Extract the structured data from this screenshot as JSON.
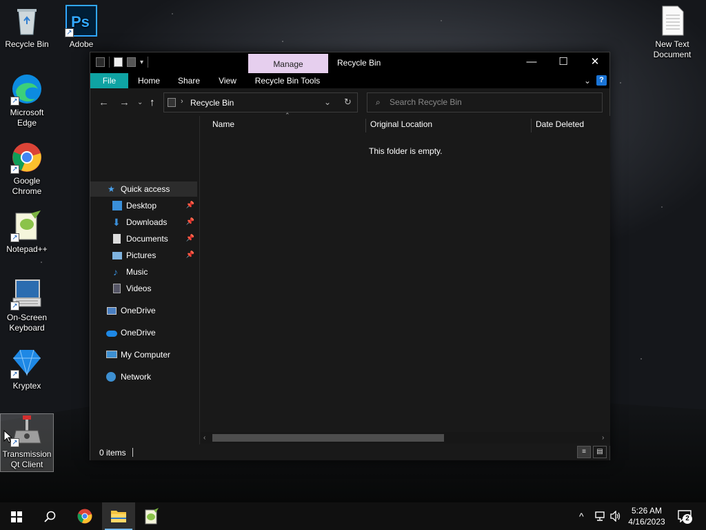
{
  "desktop": {
    "icons": [
      {
        "label": "Recycle Bin"
      },
      {
        "label": "Adobe Photosh"
      },
      {
        "label": "Microsoft Edge"
      },
      {
        "label": "Google Chrome"
      },
      {
        "label": "Notepad++"
      },
      {
        "label": "On-Screen Keyboard"
      },
      {
        "label": "Kryptex"
      },
      {
        "label": "Transmission Qt Client"
      },
      {
        "label": "New Text Document"
      }
    ],
    "shortcut_arrow": "↗"
  },
  "explorer": {
    "title": "Recycle Bin",
    "contextual_tab": "Manage",
    "ribbon_tabs": [
      "File",
      "Home",
      "Share",
      "View",
      "Recycle Bin Tools"
    ],
    "address": {
      "crumb": "Recycle Bin"
    },
    "search": {
      "placeholder": "Search Recycle Bin"
    },
    "nav": {
      "quick_access": "Quick access",
      "items": [
        {
          "label": "Desktop",
          "pinned": true
        },
        {
          "label": "Downloads",
          "pinned": true
        },
        {
          "label": "Documents",
          "pinned": true
        },
        {
          "label": "Pictures",
          "pinned": true
        },
        {
          "label": "Music",
          "pinned": false
        },
        {
          "label": "Videos",
          "pinned": false
        }
      ],
      "onedrive_1": "OneDrive",
      "onedrive_2": "OneDrive",
      "my_computer": "My Computer",
      "network": "Network"
    },
    "columns": [
      "Name",
      "Original Location",
      "Date Deleted"
    ],
    "empty_message": "This folder is empty.",
    "status": "0 items"
  },
  "taskbar": {
    "time": "5:26 AM",
    "date": "4/16/2023",
    "notifications": "2"
  },
  "colors": {
    "file_tab": "#0fa3a3",
    "manage_tab": "#e6cfee",
    "accent": "#76b9ed"
  }
}
